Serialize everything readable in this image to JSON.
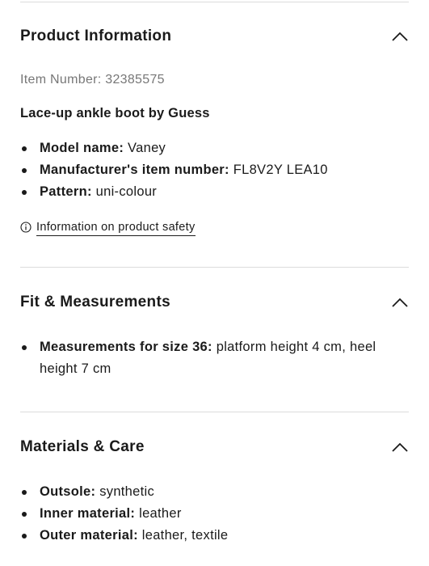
{
  "product_info": {
    "title": "Product Information",
    "item_number": "Item Number: 32385575",
    "description": "Lace-up ankle boot by Guess",
    "specs": [
      {
        "label": "Model name:",
        "value": "Vaney"
      },
      {
        "label": "Manufacturer's item number:",
        "value": "FL8V2Y LEA10"
      },
      {
        "label": "Pattern:",
        "value": "uni-colour"
      }
    ],
    "safety_link": "Information on product safety"
  },
  "fit": {
    "title": "Fit & Measurements",
    "specs": [
      {
        "label": "Measurements for size 36:",
        "value": "platform height 4 cm, heel height 7 cm"
      }
    ]
  },
  "materials": {
    "title": "Materials & Care",
    "specs": [
      {
        "label": "Outsole:",
        "value": "synthetic"
      },
      {
        "label": "Inner material:",
        "value": "leather"
      },
      {
        "label": "Outer material:",
        "value": "leather, textile"
      }
    ]
  },
  "icons": {
    "chevron": "chevron-up-icon",
    "info": "info-icon"
  },
  "colors": {
    "text": "#1a1a1a",
    "muted": "#777777",
    "divider": "#dcdcdc"
  }
}
